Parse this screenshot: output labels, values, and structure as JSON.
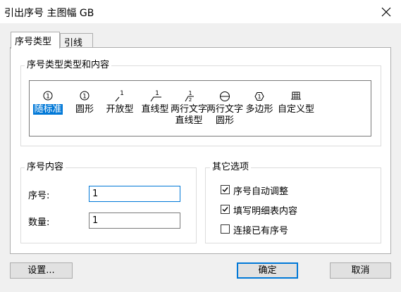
{
  "window": {
    "title": "引出序号 主图幅 GB"
  },
  "tabs": [
    "序号类型",
    "引线"
  ],
  "type_group": {
    "title": "序号类型类型和内容",
    "items": [
      {
        "lines": [
          "随标准"
        ],
        "icon": "circled-one-icon",
        "selected": true
      },
      {
        "lines": [
          "圆形"
        ],
        "icon": "circle-one-icon",
        "selected": false
      },
      {
        "lines": [
          "开放型"
        ],
        "icon": "open-leader-icon",
        "selected": false
      },
      {
        "lines": [
          "直线型"
        ],
        "icon": "line-leader-icon",
        "selected": false
      },
      {
        "lines": [
          "两行文字",
          "直线型"
        ],
        "icon": "two-line-text-icon",
        "selected": false
      },
      {
        "lines": [
          "两行文字",
          "圆形"
        ],
        "icon": "split-circle-icon",
        "selected": false
      },
      {
        "lines": [
          "多边形"
        ],
        "icon": "polygon-icon",
        "selected": false
      },
      {
        "lines": [
          "自定义型"
        ],
        "icon": "custom-grid-icon",
        "selected": false
      }
    ]
  },
  "content_group": {
    "title": "序号内容",
    "number_label": "序号:",
    "number_value": "1",
    "count_label": "数量:",
    "count_value": "1"
  },
  "options_group": {
    "title": "其它选项",
    "options": [
      {
        "label": "序号自动调整",
        "checked": true
      },
      {
        "label": "填写明细表内容",
        "checked": true
      },
      {
        "label": "连接已有序号",
        "checked": false
      }
    ]
  },
  "buttons": {
    "settings": "设置...",
    "ok": "确定",
    "cancel": "取消"
  },
  "colors": {
    "selection": "#0078d7",
    "focus_border": "#0078d7"
  }
}
